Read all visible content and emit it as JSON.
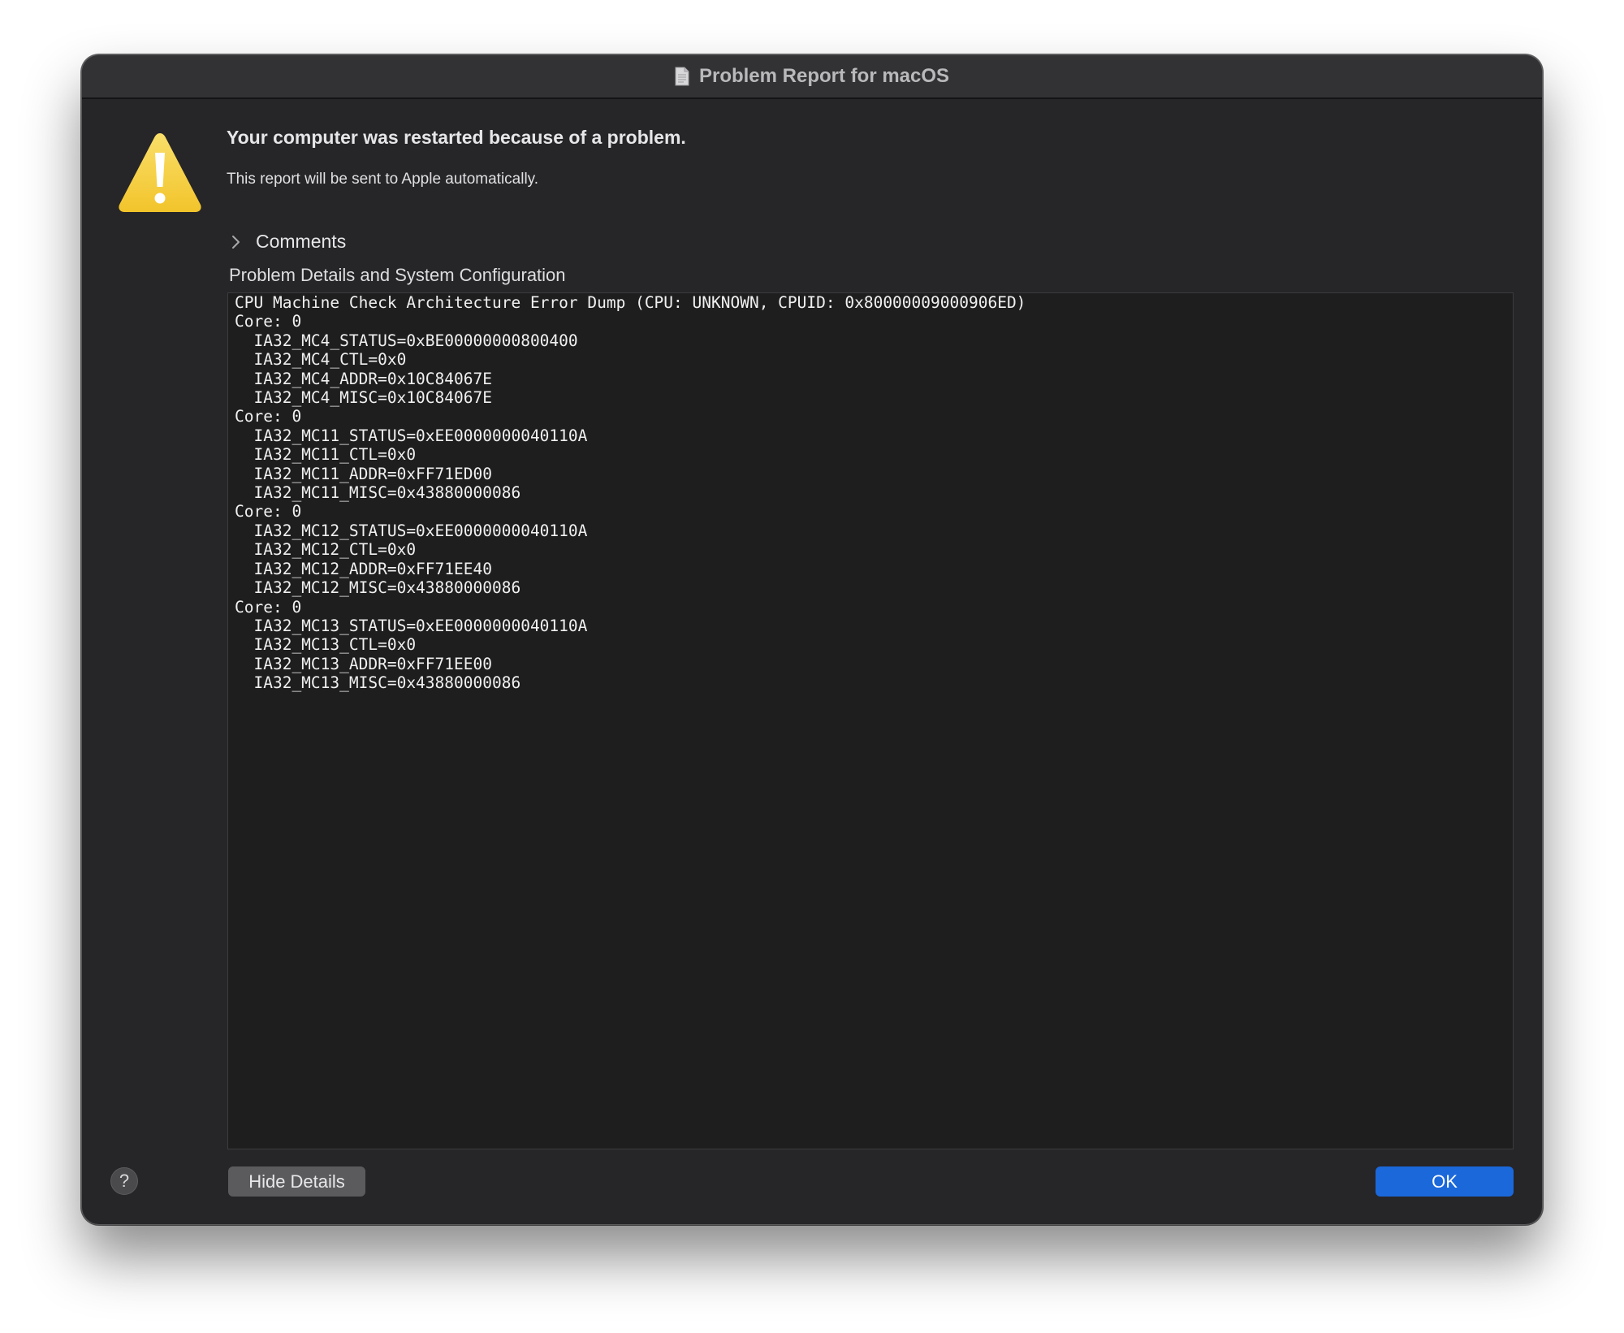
{
  "window": {
    "title": "Problem Report for macOS",
    "title_icon": "document-icon"
  },
  "alert": {
    "icon": "warning-icon",
    "headline": "Your computer was restarted because of a problem.",
    "subtext": "This report will be sent to Apple automatically."
  },
  "comments": {
    "label": "Comments",
    "expanded": false
  },
  "details": {
    "label": "Problem Details and System Configuration",
    "lines": [
      "CPU Machine Check Architecture Error Dump (CPU: UNKNOWN, CPUID: 0x80000009000906ED)",
      "Core: 0",
      "  IA32_MC4_STATUS=0xBE00000000800400",
      "  IA32_MC4_CTL=0x0",
      "  IA32_MC4_ADDR=0x10C84067E",
      "  IA32_MC4_MISC=0x10C84067E",
      "Core: 0",
      "  IA32_MC11_STATUS=0xEE0000000040110A",
      "  IA32_MC11_CTL=0x0",
      "  IA32_MC11_ADDR=0xFF71ED00",
      "  IA32_MC11_MISC=0x43880000086",
      "Core: 0",
      "  IA32_MC12_STATUS=0xEE0000000040110A",
      "  IA32_MC12_CTL=0x0",
      "  IA32_MC12_ADDR=0xFF71EE40",
      "  IA32_MC12_MISC=0x43880000086",
      "Core: 0",
      "  IA32_MC13_STATUS=0xEE0000000040110A",
      "  IA32_MC13_CTL=0x0",
      "  IA32_MC13_ADDR=0xFF71EE00",
      "  IA32_MC13_MISC=0x43880000086"
    ]
  },
  "footer": {
    "help_label": "?",
    "hide_details_label": "Hide Details",
    "ok_label": "OK"
  },
  "colors": {
    "window_bg": "#262528",
    "titlebar_bg": "#323134",
    "details_bg": "#1e1e1e",
    "accent": "#1b68db",
    "warning_yellow": "#f5cc3a"
  }
}
